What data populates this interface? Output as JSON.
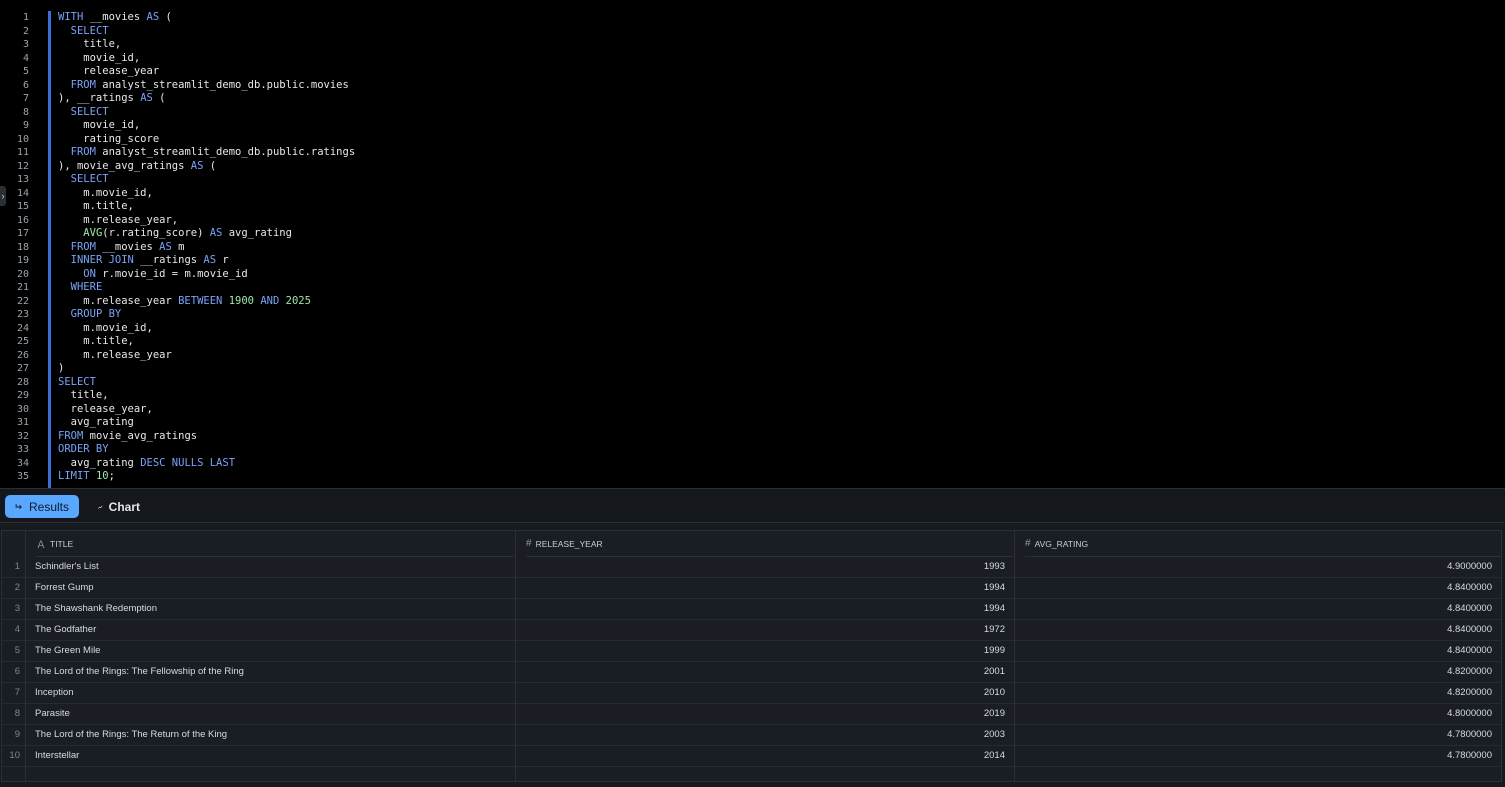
{
  "editor": {
    "line_numbers": [
      "1",
      "2",
      "3",
      "4",
      "5",
      "6",
      "7",
      "8",
      "9",
      "10",
      "11",
      "12",
      "13",
      "14",
      "15",
      "16",
      "17",
      "18",
      "19",
      "20",
      "21",
      "22",
      "23",
      "24",
      "25",
      "26",
      "27",
      "28",
      "29",
      "30",
      "31",
      "32",
      "33",
      "34",
      "35"
    ],
    "lines": [
      [
        {
          "t": "WITH",
          "k": "kw"
        },
        {
          "t": " __movies "
        },
        {
          "t": "AS",
          "k": "kw"
        },
        {
          "t": " ("
        }
      ],
      [
        {
          "t": "  "
        },
        {
          "t": "SELECT",
          "k": "kw"
        }
      ],
      [
        {
          "t": "    title,"
        }
      ],
      [
        {
          "t": "    movie_id,"
        }
      ],
      [
        {
          "t": "    release_year"
        }
      ],
      [
        {
          "t": "  "
        },
        {
          "t": "FROM",
          "k": "kw"
        },
        {
          "t": " analyst_streamlit_demo_db.public.movies"
        }
      ],
      [
        {
          "t": "), __ratings "
        },
        {
          "t": "AS",
          "k": "kw"
        },
        {
          "t": " ("
        }
      ],
      [
        {
          "t": "  "
        },
        {
          "t": "SELECT",
          "k": "kw"
        }
      ],
      [
        {
          "t": "    movie_id,"
        }
      ],
      [
        {
          "t": "    rating_score"
        }
      ],
      [
        {
          "t": "  "
        },
        {
          "t": "FROM",
          "k": "kw"
        },
        {
          "t": " analyst_streamlit_demo_db.public.ratings"
        }
      ],
      [
        {
          "t": "), movie_avg_ratings "
        },
        {
          "t": "AS",
          "k": "kw"
        },
        {
          "t": " ("
        }
      ],
      [
        {
          "t": "  "
        },
        {
          "t": "SELECT",
          "k": "kw"
        }
      ],
      [
        {
          "t": "    m.movie_id,"
        }
      ],
      [
        {
          "t": "    m.title,"
        }
      ],
      [
        {
          "t": "    m.release_year,"
        }
      ],
      [
        {
          "t": "    "
        },
        {
          "t": "AVG",
          "k": "num"
        },
        {
          "t": "(r.rating_score) "
        },
        {
          "t": "AS",
          "k": "kw"
        },
        {
          "t": " avg_rating"
        }
      ],
      [
        {
          "t": "  "
        },
        {
          "t": "FROM",
          "k": "kw"
        },
        {
          "t": " __movies "
        },
        {
          "t": "AS",
          "k": "kw"
        },
        {
          "t": " m"
        }
      ],
      [
        {
          "t": "  "
        },
        {
          "t": "INNER JOIN",
          "k": "kw"
        },
        {
          "t": " __ratings "
        },
        {
          "t": "AS",
          "k": "kw"
        },
        {
          "t": " r"
        }
      ],
      [
        {
          "t": "    "
        },
        {
          "t": "ON",
          "k": "kw"
        },
        {
          "t": " r.movie_id = m.movie_id"
        }
      ],
      [
        {
          "t": "  "
        },
        {
          "t": "WHERE",
          "k": "kw"
        }
      ],
      [
        {
          "t": "    m.release_year "
        },
        {
          "t": "BETWEEN",
          "k": "kw"
        },
        {
          "t": " "
        },
        {
          "t": "1900",
          "k": "num"
        },
        {
          "t": " "
        },
        {
          "t": "AND",
          "k": "kw"
        },
        {
          "t": " "
        },
        {
          "t": "2025",
          "k": "num"
        }
      ],
      [
        {
          "t": "  "
        },
        {
          "t": "GROUP BY",
          "k": "kw"
        }
      ],
      [
        {
          "t": "    m.movie_id,"
        }
      ],
      [
        {
          "t": "    m.title,"
        }
      ],
      [
        {
          "t": "    m.release_year"
        }
      ],
      [
        {
          "t": ")"
        }
      ],
      [
        {
          "t": "SELECT",
          "k": "kw"
        }
      ],
      [
        {
          "t": "  title,"
        }
      ],
      [
        {
          "t": "  release_year,"
        }
      ],
      [
        {
          "t": "  avg_rating"
        }
      ],
      [
        {
          "t": "FROM",
          "k": "kw"
        },
        {
          "t": " movie_avg_ratings"
        }
      ],
      [
        {
          "t": "ORDER BY",
          "k": "kw"
        }
      ],
      [
        {
          "t": "  avg_rating "
        },
        {
          "t": "DESC NULLS LAST",
          "k": "kw"
        }
      ],
      [
        {
          "t": "LIMIT",
          "k": "kw"
        },
        {
          "t": " "
        },
        {
          "t": "10",
          "k": "num"
        },
        {
          "t": ";"
        }
      ]
    ]
  },
  "tabs": {
    "results_label": "Results",
    "chart_label": "Chart"
  },
  "table": {
    "columns": [
      "TITLE",
      "RELEASE_YEAR",
      "AVG_RATING"
    ],
    "rows": [
      {
        "idx": "1",
        "title": "Schindler's List",
        "year": "1993",
        "avg": "4.9000000"
      },
      {
        "idx": "2",
        "title": "Forrest Gump",
        "year": "1994",
        "avg": "4.8400000"
      },
      {
        "idx": "3",
        "title": "The Shawshank Redemption",
        "year": "1994",
        "avg": "4.8400000"
      },
      {
        "idx": "4",
        "title": "The Godfather",
        "year": "1972",
        "avg": "4.8400000"
      },
      {
        "idx": "5",
        "title": "The Green Mile",
        "year": "1999",
        "avg": "4.8400000"
      },
      {
        "idx": "6",
        "title": "The Lord of the Rings: The Fellowship of the Ring",
        "year": "2001",
        "avg": "4.8200000"
      },
      {
        "idx": "7",
        "title": "Inception",
        "year": "2010",
        "avg": "4.8200000"
      },
      {
        "idx": "8",
        "title": "Parasite",
        "year": "2019",
        "avg": "4.8000000"
      },
      {
        "idx": "9",
        "title": "The Lord of the Rings: The Return of the King",
        "year": "2003",
        "avg": "4.7800000"
      },
      {
        "idx": "10",
        "title": "Interstellar",
        "year": "2014",
        "avg": "4.7800000"
      }
    ]
  },
  "colors": {
    "accent": "#5aa7ff",
    "keyword": "#7aa2f7",
    "number": "#9ee6a8"
  }
}
